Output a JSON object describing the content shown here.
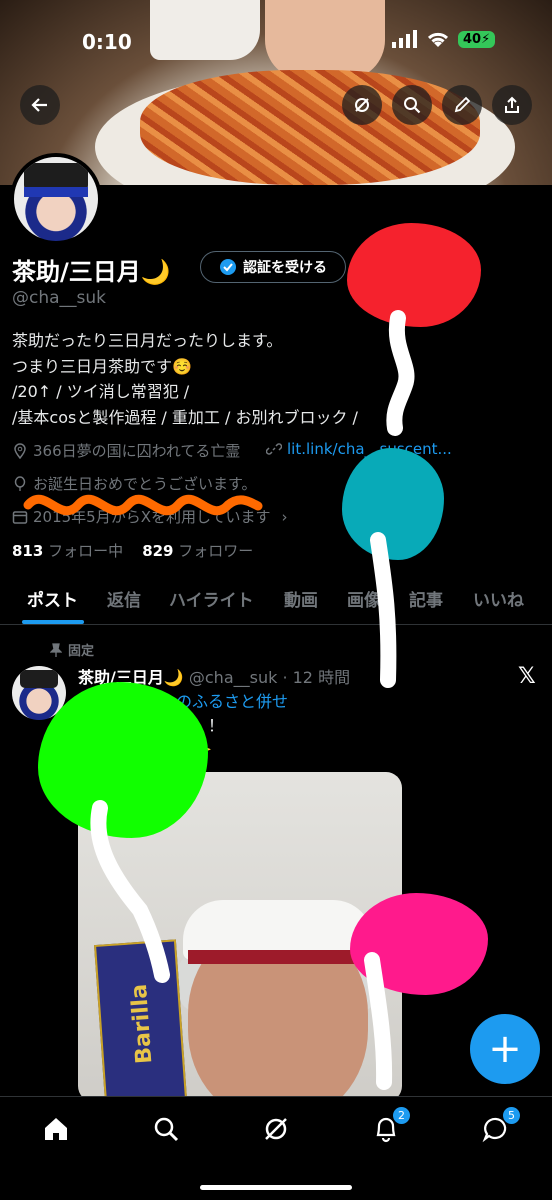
{
  "status_bar": {
    "time": "0:10",
    "battery": "40"
  },
  "profile": {
    "name": "茶助/三日月🌙",
    "verify_button": "認証を受ける",
    "handle": "@cha__suk",
    "bio_lines": [
      "茶助だったり三日月だったりします。",
      "つまり三日月茶助です☺️",
      "/20↑ / ツイ消し常習犯 /",
      "/基本cosと製作過程 / 重加工 / お別れブロック /"
    ],
    "location": "366日夢の国に囚われてる亡霊",
    "link": "lit.link/cha__suscent...",
    "birthday": "お誕生日おめでとうございます。",
    "joined": "2015年5月からXを利用しています",
    "following_count": "813",
    "following_label": "フォロー中",
    "followers_count": "829",
    "followers_label": "フォロワー"
  },
  "tabs": [
    "ポスト",
    "返信",
    "ハイライト",
    "動画",
    "画像",
    "記事",
    "いいね"
  ],
  "tweet": {
    "pinned_label": "固定",
    "name": "茶助/三日月🌙",
    "handle_time": "@cha__suk · 12 時間",
    "text_line1": "のふるさと併せ",
    "text_line2": "！！！",
    "text_line3": "ー✨",
    "media_text": "Barilla"
  },
  "nav": {
    "notifications_badge": "2",
    "messages_badge": "5"
  },
  "fab_label": "+",
  "colors": {
    "accent": "#1d9bf0",
    "background": "#000000",
    "muted": "#71767b"
  }
}
